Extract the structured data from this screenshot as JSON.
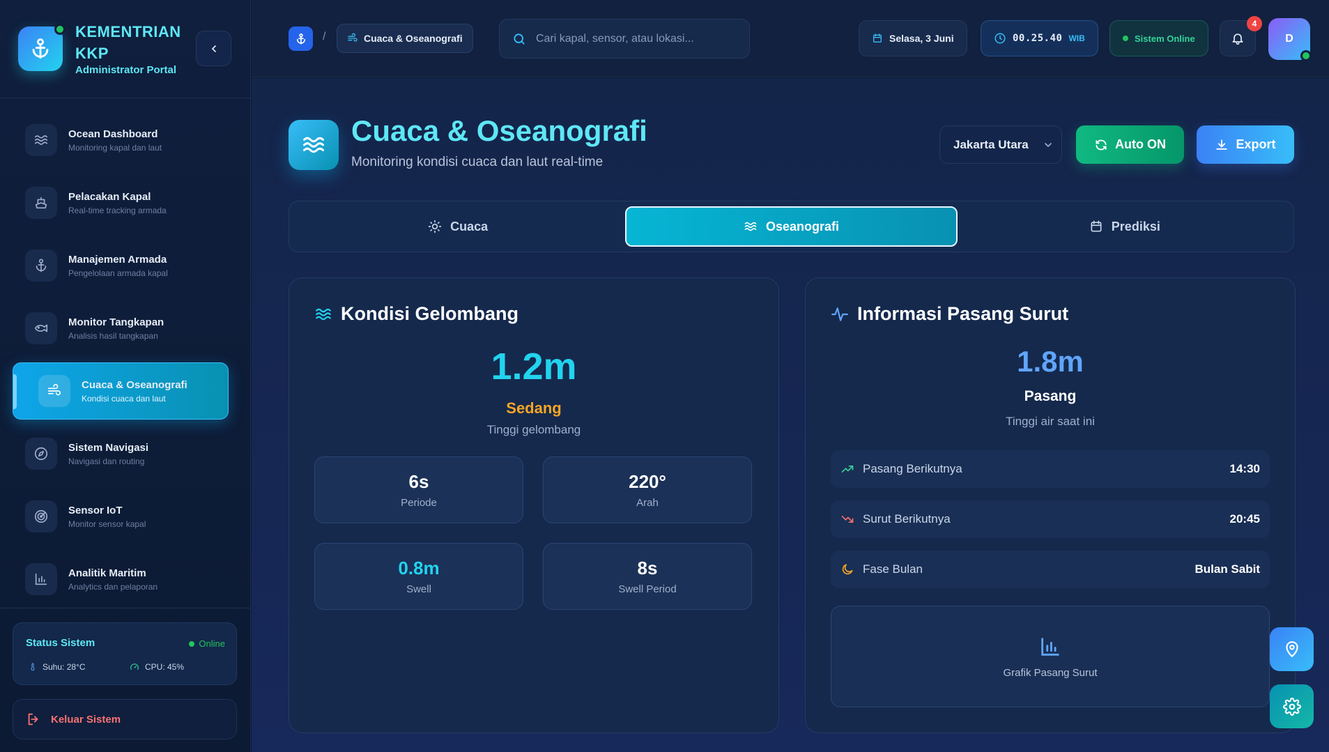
{
  "brand": {
    "title": "KEMENTRIAN KKP",
    "subtitle": "Administrator Portal"
  },
  "sidebar": {
    "items": [
      {
        "label": "Ocean Dashboard",
        "desc": "Monitoring kapal dan laut",
        "icon": "waves-icon"
      },
      {
        "label": "Pelacakan Kapal",
        "desc": "Real-time tracking armada",
        "icon": "ship-icon"
      },
      {
        "label": "Manajemen Armada",
        "desc": "Pengelolaan armada kapal",
        "icon": "anchor-icon"
      },
      {
        "label": "Monitor Tangkapan",
        "desc": "Analisis hasil tangkapan",
        "icon": "fish-icon"
      },
      {
        "label": "Cuaca & Oseanografi",
        "desc": "Kondisi cuaca dan laut",
        "icon": "wind-icon",
        "active": true
      },
      {
        "label": "Sistem Navigasi",
        "desc": "Navigasi dan routing",
        "icon": "compass-icon"
      },
      {
        "label": "Sensor IoT",
        "desc": "Monitor sensor kapal",
        "icon": "radar-icon"
      },
      {
        "label": "Analitik Maritim",
        "desc": "Analytics dan pelaporan",
        "icon": "bar-chart-icon"
      }
    ],
    "status": {
      "title": "Status Sistem",
      "online": "Online",
      "temp": "Suhu: 28°C",
      "cpu": "CPU: 45%"
    },
    "logout": "Keluar Sistem"
  },
  "topbar": {
    "breadcrumb_sep": "/",
    "breadcrumb_current": "Cuaca & Oseanografi",
    "search_placeholder": "Cari kapal, sensor, atau lokasi...",
    "date": "Selasa, 3 Juni",
    "time": "00.25.40",
    "timezone": "WIB",
    "system_status": "Sistem Online",
    "notifications": "4",
    "avatar_initial": "D"
  },
  "page": {
    "title": "Cuaca & Oseanografi",
    "subtitle": "Monitoring kondisi cuaca dan laut real-time",
    "location": "Jakarta Utara",
    "auto_label": "Auto ON",
    "export_label": "Export",
    "tabs": [
      {
        "label": "Cuaca"
      },
      {
        "label": "Oseanografi",
        "active": true
      },
      {
        "label": "Prediksi"
      }
    ]
  },
  "wave": {
    "title": "Kondisi Gelombang",
    "height": "1.2m",
    "category": "Sedang",
    "height_label": "Tinggi gelombang",
    "stats": [
      {
        "value": "6s",
        "label": "Periode"
      },
      {
        "value": "220°",
        "label": "Arah"
      },
      {
        "value": "0.8m",
        "label": "Swell"
      },
      {
        "value": "8s",
        "label": "Swell Period"
      }
    ]
  },
  "tide": {
    "title": "Informasi Pasang Surut",
    "height": "1.8m",
    "state": "Pasang",
    "height_label": "Tinggi air saat ini",
    "rows": [
      {
        "label": "Pasang Berikutnya",
        "value": "14:30"
      },
      {
        "label": "Surut Berikutnya",
        "value": "20:45"
      },
      {
        "label": "Fase Bulan",
        "value": "Bulan Sabit"
      }
    ],
    "chart_label": "Grafik Pasang Surut"
  },
  "colors": {
    "accent": "#22d3ee",
    "brand": "#5ee7f5",
    "success": "#10b981",
    "primary": "#3b82f6",
    "warning": "#f5a524"
  }
}
